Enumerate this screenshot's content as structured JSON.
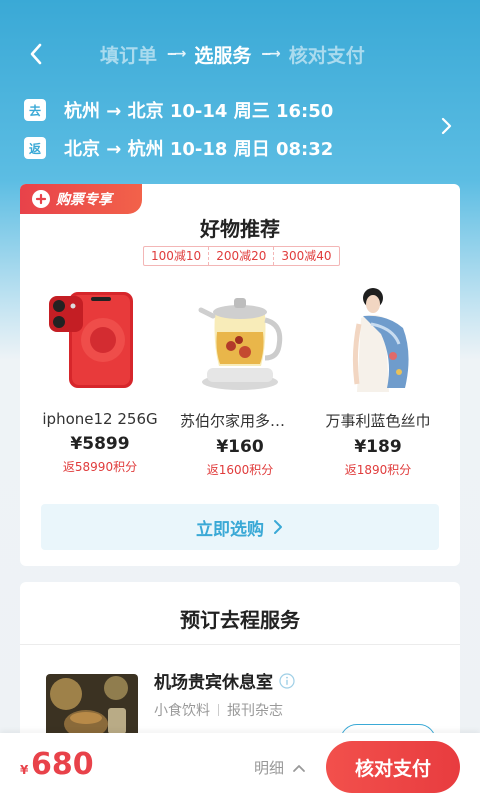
{
  "header": {
    "steps": [
      "填订单",
      "选服务",
      "核对支付"
    ],
    "active_step": 1,
    "step_arrow": "--→"
  },
  "trip": {
    "outbound": {
      "tag": "去",
      "text": "杭州 → 北京  10-14  周三  16:50"
    },
    "return": {
      "tag": "返",
      "text": "北京 → 杭州  10-18  周日  08:32"
    }
  },
  "goods_card": {
    "badge": "购票专享",
    "title": "好物推荐",
    "coupons": [
      "100减10",
      "200减20",
      "300减40"
    ],
    "products": [
      {
        "name": "iphone12 256G",
        "price": "¥5899",
        "points": "返58990积分",
        "image": "red-phone"
      },
      {
        "name": "苏伯尔家用多功能养生壶",
        "price": "¥160",
        "points": "返1600积分",
        "image": "health-kettle"
      },
      {
        "name": "万事利蓝色丝巾",
        "price": "¥189",
        "points": "返1890积分",
        "image": "silk-scarf-model"
      }
    ],
    "buy_now_label": "立即选购"
  },
  "service_card": {
    "title": "预订去程服务",
    "lounge": {
      "title": "机场贵宾休息室",
      "tags": [
        "小食饮料",
        "报刊杂志"
      ]
    }
  },
  "bottom_bar": {
    "currency": "¥",
    "price": "680",
    "detail_label": "明细",
    "pay_label": "核对支付"
  },
  "colors": {
    "accent": "#3aa9d6",
    "price_red": "#e8424a"
  }
}
